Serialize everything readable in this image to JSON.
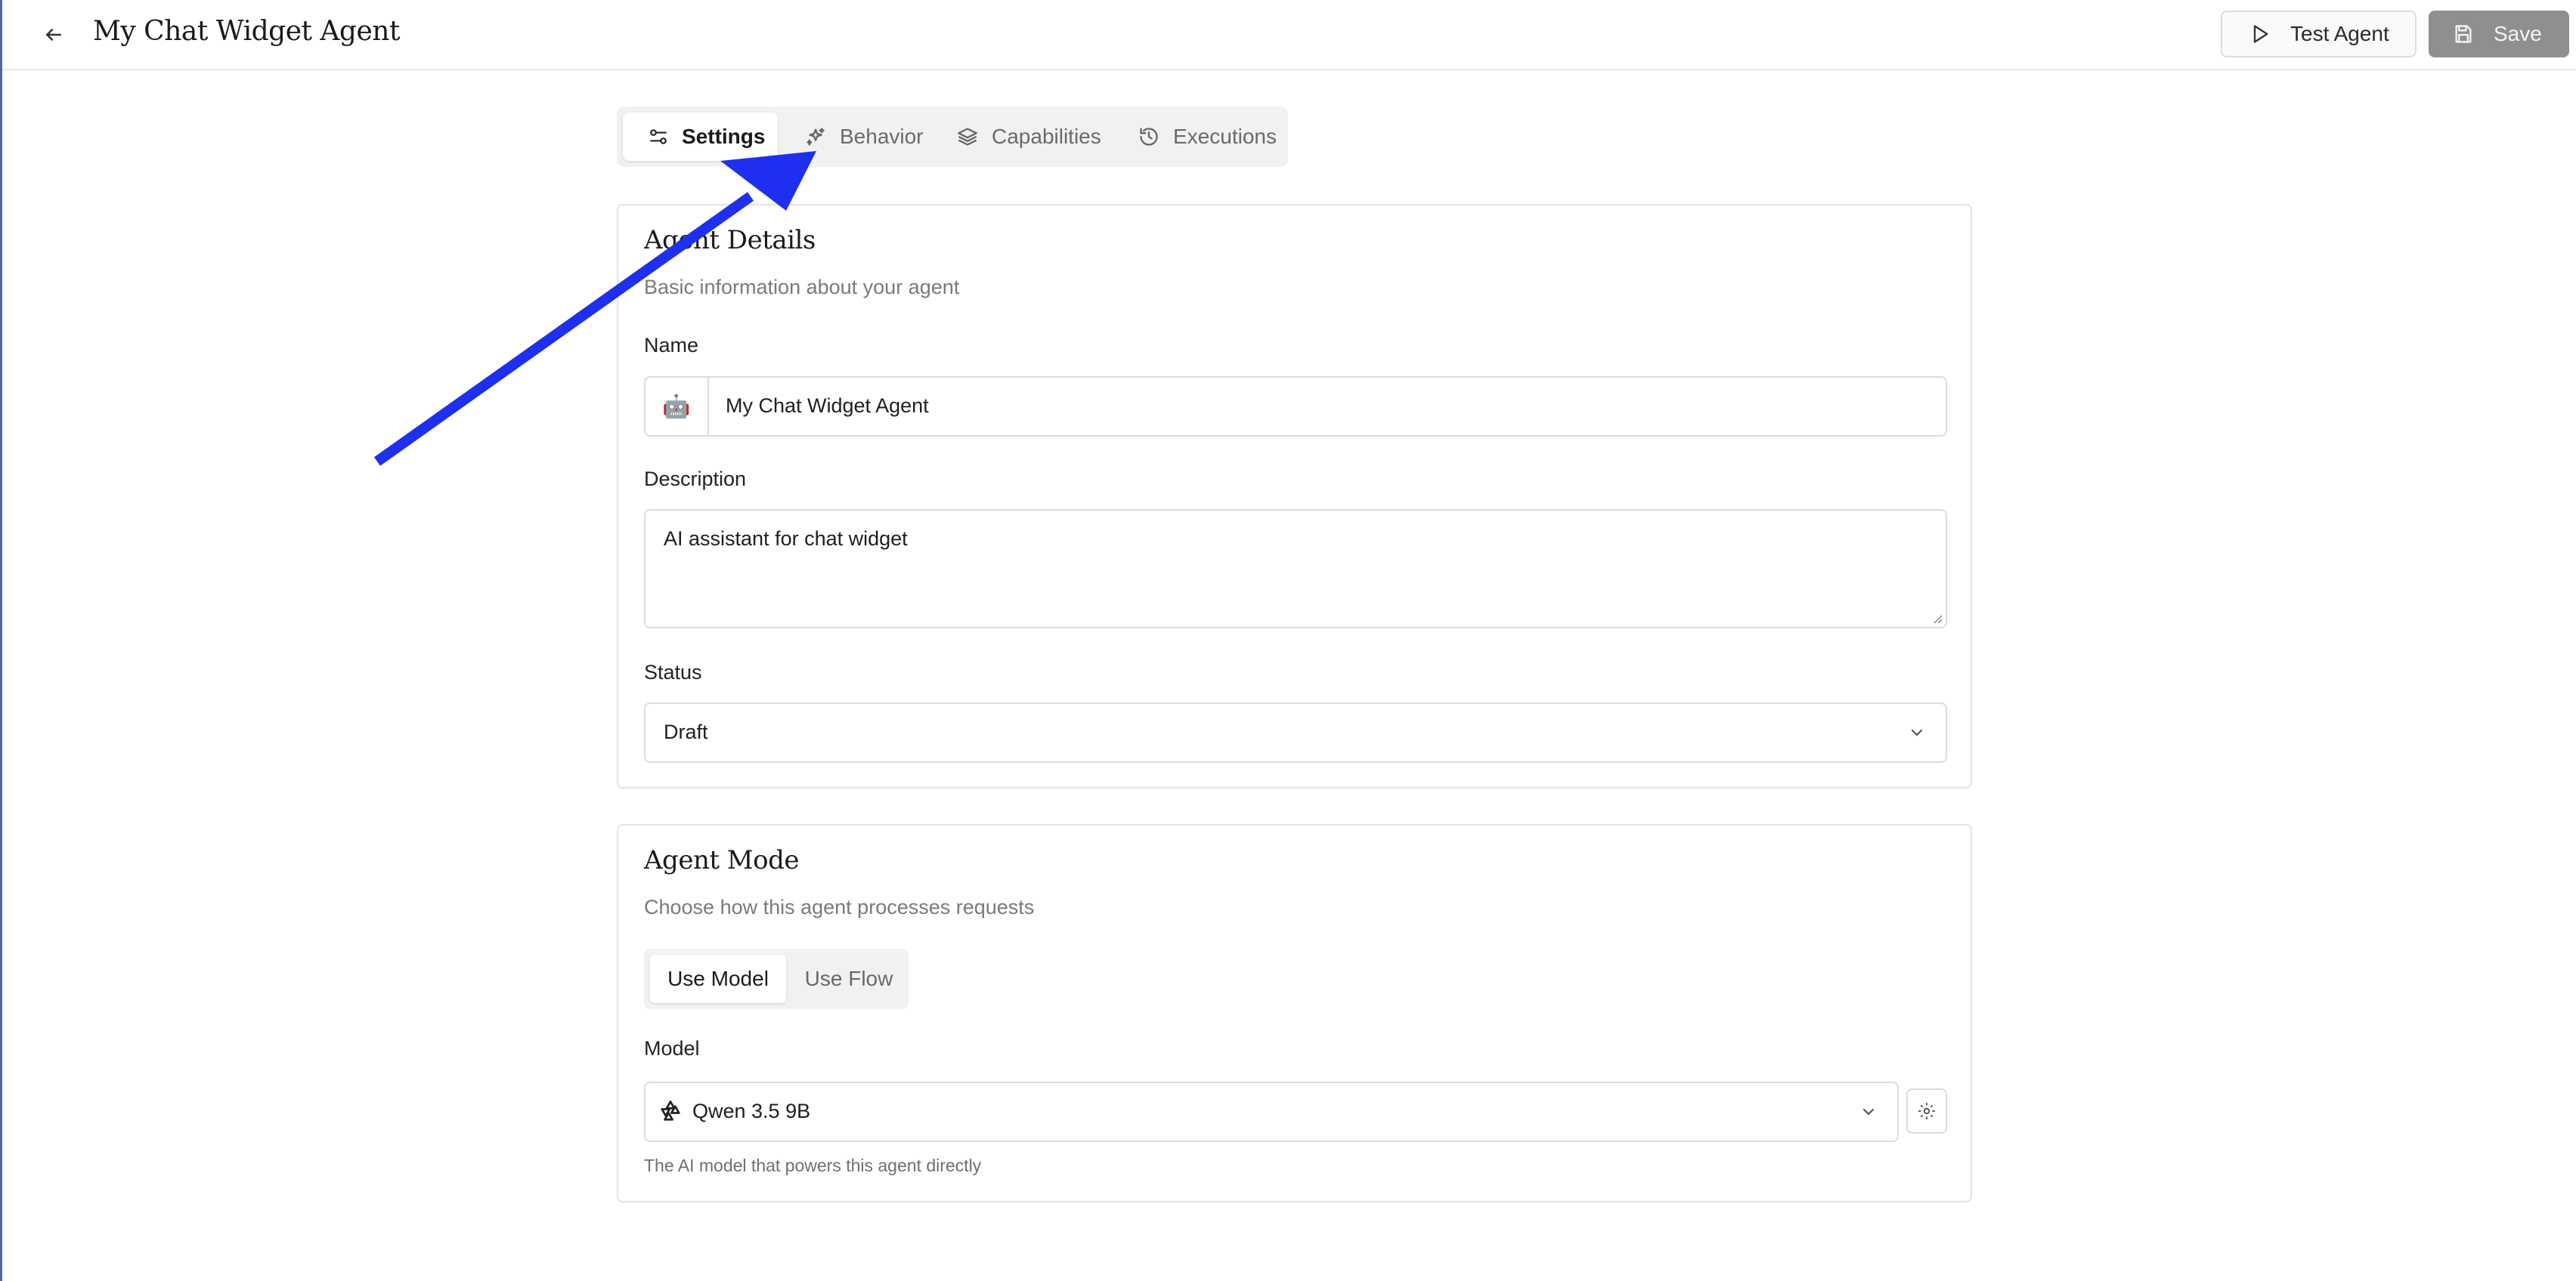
{
  "header": {
    "title": "My Chat Widget Agent",
    "test_label": "Test Agent",
    "save_label": "Save"
  },
  "tabs": [
    {
      "label": "Settings",
      "active": true,
      "icon": "sliders-icon"
    },
    {
      "label": "Behavior",
      "active": false,
      "icon": "sparkles-icon"
    },
    {
      "label": "Capabilities",
      "active": false,
      "icon": "layers-icon"
    },
    {
      "label": "Executions",
      "active": false,
      "icon": "history-icon"
    }
  ],
  "details": {
    "title": "Agent Details",
    "subtitle": "Basic information about your agent",
    "name_label": "Name",
    "name_emoji": "🤖",
    "name_value": "My Chat Widget Agent",
    "description_label": "Description",
    "description_value": "AI assistant for chat widget",
    "status_label": "Status",
    "status_value": "Draft"
  },
  "mode": {
    "title": "Agent Mode",
    "subtitle": "Choose how this agent processes requests",
    "options": [
      {
        "label": "Use Model",
        "active": true
      },
      {
        "label": "Use Flow",
        "active": false
      }
    ],
    "model_label": "Model",
    "model_value": "Qwen 3.5 9B",
    "model_help": "The AI model that powers this agent directly"
  },
  "colors": {
    "accent_arrow": "#1f2ff0",
    "save_button_bg": "#8f8f8f"
  }
}
